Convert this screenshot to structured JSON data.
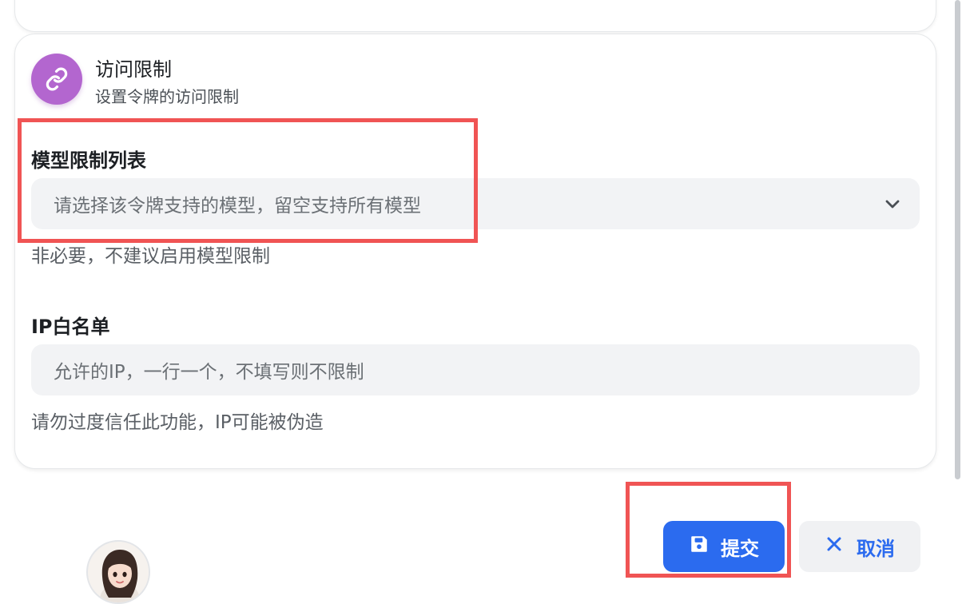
{
  "access_card": {
    "title": "访问限制",
    "subtitle": "设置令牌的访问限制",
    "icon": "link-icon",
    "icon_color": "#b366cf"
  },
  "model_limit": {
    "label": "模型限制列表",
    "placeholder": "请选择该令牌支持的模型，留空支持所有模型",
    "helper": "非必要，不建议启用模型限制"
  },
  "ip_whitelist": {
    "label": "IP白名单",
    "placeholder": "允许的IP，一行一个，不填写则不限制",
    "helper": "请勿过度信任此功能，IP可能被伪造"
  },
  "actions": {
    "submit_label": "提交",
    "cancel_label": "取消",
    "submit_color": "#2b6bef"
  },
  "highlight_color": "#f05454"
}
